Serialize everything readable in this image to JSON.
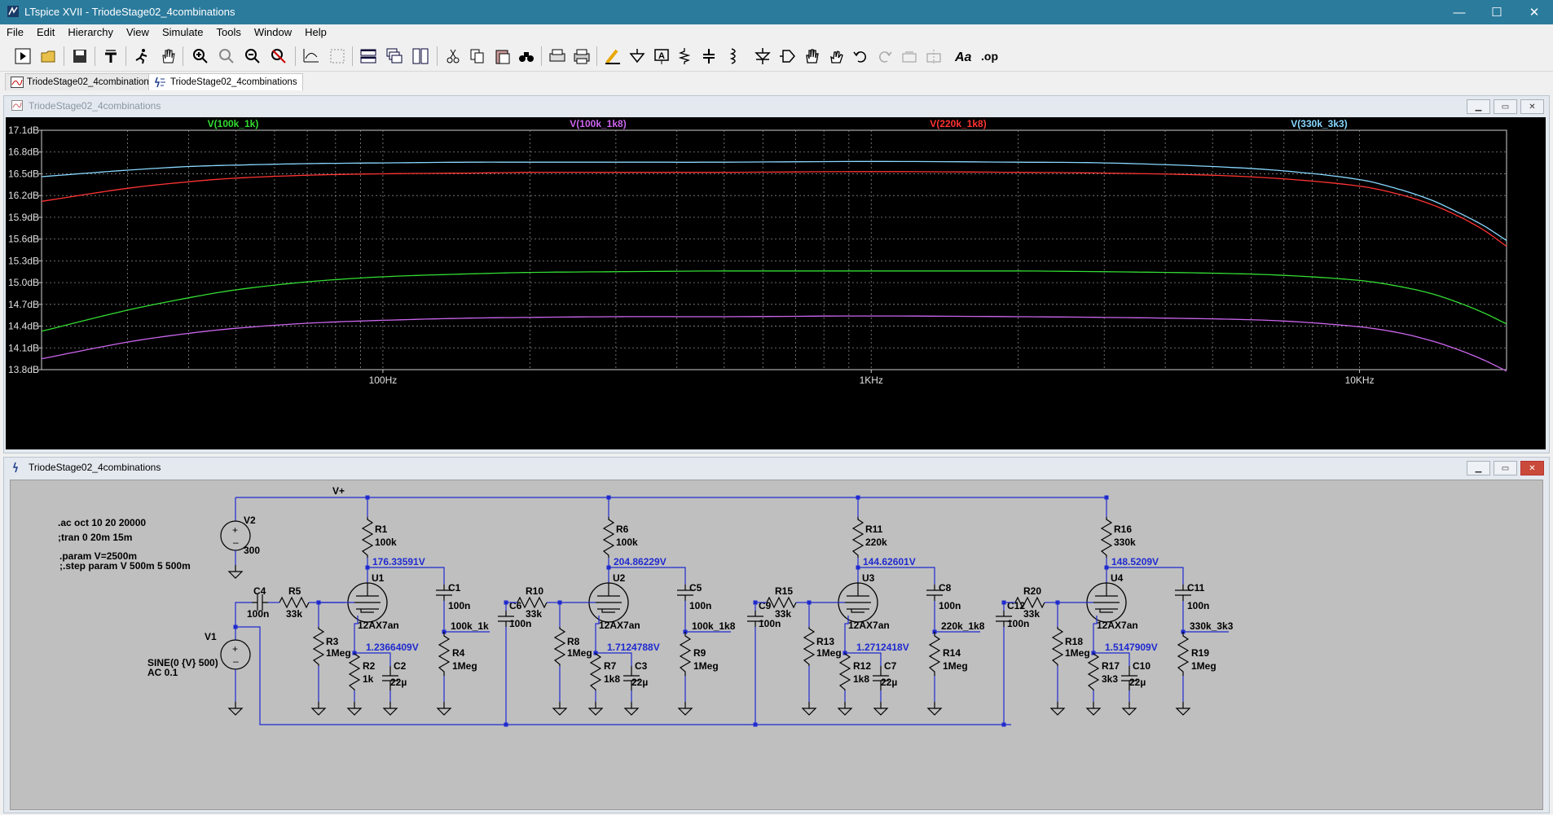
{
  "window": {
    "title": "LTspice XVII - TriodeStage02_4combinations",
    "minimize": "—",
    "maximize": "☐",
    "close": "✕"
  },
  "menu": [
    "File",
    "Edit",
    "Hierarchy",
    "View",
    "Simulate",
    "Tools",
    "Window",
    "Help"
  ],
  "tabs": [
    {
      "label": "TriodeStage02_4combinations",
      "kind": "plot"
    },
    {
      "label": "TriodeStage02_4combinations",
      "kind": "schematic",
      "active": true
    }
  ],
  "plot_window": {
    "title": "TriodeStage02_4combinations"
  },
  "schematic_window": {
    "title": "TriodeStage02_4combinations"
  },
  "toolbar": {
    "font_tool": "Aa",
    "spice_directive": ".op"
  },
  "chart_data": {
    "type": "line",
    "xscale": "log",
    "xlim": [
      20,
      20000
    ],
    "ylim": [
      13.8,
      17.1
    ],
    "yticks": [
      "17.1dB",
      "16.8dB",
      "16.5dB",
      "16.2dB",
      "15.9dB",
      "15.6dB",
      "15.3dB",
      "15.0dB",
      "14.7dB",
      "14.4dB",
      "14.1dB",
      "13.8dB"
    ],
    "xticks": [
      {
        "label": "100Hz",
        "value": 100
      },
      {
        "label": "1KHz",
        "value": 1000
      },
      {
        "label": "10KHz",
        "value": 10000
      }
    ],
    "grid": true,
    "x": [
      20,
      30,
      40,
      50,
      70,
      100,
      150,
      200,
      300,
      500,
      1000,
      2000,
      3000,
      5000,
      7000,
      10000,
      12000,
      14000,
      16000,
      18000,
      20000
    ],
    "series": [
      {
        "name": "V(100k_1k)",
        "color": "#33dd33",
        "values": [
          14.33,
          14.62,
          14.79,
          14.9,
          15.01,
          15.08,
          15.12,
          15.14,
          15.15,
          15.16,
          15.16,
          15.16,
          15.15,
          15.13,
          15.1,
          15.03,
          14.95,
          14.85,
          14.72,
          14.58,
          14.43
        ]
      },
      {
        "name": "V(100k_1k8)",
        "color": "#cc66ee",
        "values": [
          13.95,
          14.18,
          14.3,
          14.37,
          14.44,
          14.48,
          14.51,
          14.52,
          14.53,
          14.53,
          14.54,
          14.53,
          14.52,
          14.5,
          14.47,
          14.39,
          14.31,
          14.2,
          14.07,
          13.93,
          13.78
        ]
      },
      {
        "name": "V(220k_1k8)",
        "color": "#ff3333",
        "values": [
          16.12,
          16.3,
          16.39,
          16.44,
          16.48,
          16.5,
          16.51,
          16.52,
          16.52,
          16.52,
          16.53,
          16.52,
          16.51,
          16.48,
          16.43,
          16.33,
          16.22,
          16.08,
          15.91,
          15.72,
          15.5
        ]
      },
      {
        "name": "V(330k_3k3)",
        "color": "#88d8ff",
        "values": [
          16.46,
          16.55,
          16.6,
          16.62,
          16.64,
          16.65,
          16.66,
          16.66,
          16.66,
          16.66,
          16.67,
          16.66,
          16.65,
          16.6,
          16.54,
          16.42,
          16.29,
          16.14,
          15.96,
          15.78,
          15.58
        ]
      }
    ]
  },
  "schematic": {
    "supply_label": "V+",
    "directives": [
      ".ac oct 10 20 20000",
      ";tran 0 20m 15m",
      ".param V=2500m",
      ";.step param V 500m 5 500m"
    ],
    "v2": {
      "name": "V2",
      "value": "300"
    },
    "v1": {
      "name": "V1",
      "value": "SINE(0 {V} 500)",
      "ac": "AC 0.1"
    },
    "c4": {
      "name": "C4",
      "value": "100n"
    },
    "r5": {
      "name": "R5",
      "value": "33k"
    },
    "stages": [
      {
        "rp": "R1",
        "rpv": "100k",
        "plate": "176.33591V",
        "tube": "U1",
        "model": "12AX7an",
        "cout": "C1",
        "coutv": "100n",
        "out": "100k_1k",
        "rload": "R4",
        "rloadv": "1Meg",
        "rg": "R3",
        "rgv": "1Meg",
        "rk": "R2",
        "rkv": "1k",
        "ck": "C2",
        "ckv": "22µ",
        "vk": "1.2366409V",
        "rin": "",
        "rinv": "",
        "cin": "",
        "cinv": ""
      },
      {
        "rp": "R6",
        "rpv": "100k",
        "plate": "204.86229V",
        "tube": "U2",
        "model": "12AX7an",
        "cout": "C5",
        "coutv": "100n",
        "out": "100k_1k8",
        "rload": "R9",
        "rloadv": "1Meg",
        "rg": "R8",
        "rgv": "1Meg",
        "rk": "R7",
        "rkv": "1k8",
        "ck": "C3",
        "ckv": "22µ",
        "vk": "1.7124788V",
        "rin": "R10",
        "rinv": "33k",
        "cin": "C6",
        "cinv": "100n"
      },
      {
        "rp": "R11",
        "rpv": "220k",
        "plate": "144.62601V",
        "tube": "U3",
        "model": "12AX7an",
        "cout": "C8",
        "coutv": "100n",
        "out": "220k_1k8",
        "rload": "R14",
        "rloadv": "1Meg",
        "rg": "R13",
        "rgv": "1Meg",
        "rk": "R12",
        "rkv": "1k8",
        "ck": "C7",
        "ckv": "22µ",
        "vk": "1.2712418V",
        "rin": "R15",
        "rinv": "33k",
        "cin": "C9",
        "cinv": "100n"
      },
      {
        "rp": "R16",
        "rpv": "330k",
        "plate": "148.5209V",
        "tube": "U4",
        "model": "12AX7an",
        "cout": "C11",
        "coutv": "100n",
        "out": "330k_3k3",
        "rload": "R19",
        "rloadv": "1Meg",
        "rg": "R18",
        "rgv": "1Meg",
        "rk": "R17",
        "rkv": "3k3",
        "ck": "C10",
        "ckv": "22µ",
        "vk": "1.5147909V",
        "rin": "R20",
        "rinv": "33k",
        "cin": "C12",
        "cinv": "100n"
      }
    ]
  }
}
